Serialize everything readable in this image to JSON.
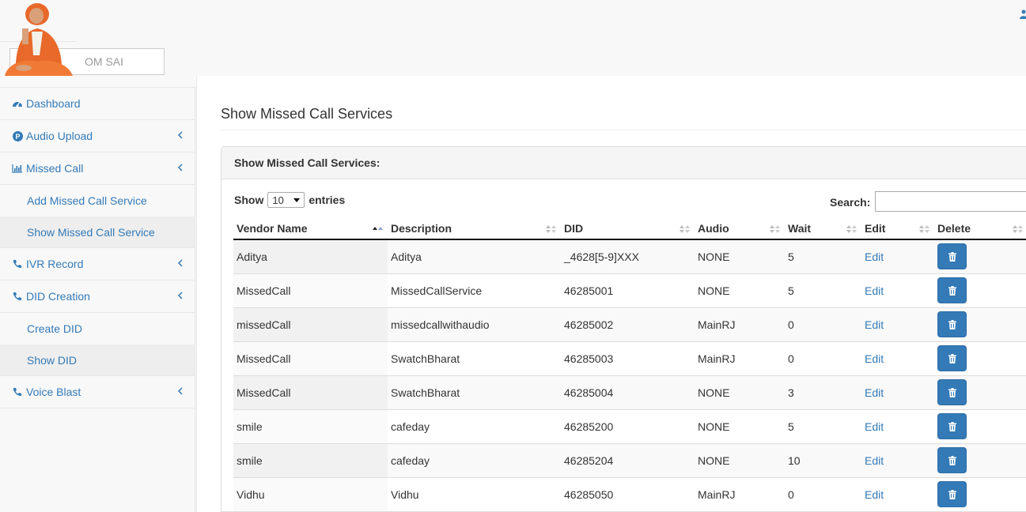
{
  "header": {
    "brand": "OM SAI"
  },
  "sidebar": {
    "items": [
      {
        "label": "Dashboard",
        "icon": "dashboard-icon"
      },
      {
        "label": "Audio Upload",
        "icon": "audio-upload-icon"
      },
      {
        "label": "Missed Call",
        "icon": "bar-chart-icon"
      },
      {
        "label": "Add Missed Call Service"
      },
      {
        "label": "Show Missed Call Service"
      },
      {
        "label": "IVR Record",
        "icon": "phone-icon"
      },
      {
        "label": "DID Creation",
        "icon": "phone-icon"
      },
      {
        "label": "Create DID"
      },
      {
        "label": "Show DID"
      },
      {
        "label": "Voice Blast",
        "icon": "phone-icon"
      }
    ]
  },
  "main": {
    "title": "Show Missed Call Services",
    "panel_title": "Show Missed Call Services:",
    "length": {
      "show": "Show",
      "value": "10",
      "entries": "entries"
    },
    "search": {
      "label": "Search:",
      "value": ""
    },
    "columns": [
      "Vendor Name",
      "Description",
      "DID",
      "Audio",
      "Wait",
      "Edit",
      "Delete"
    ],
    "rows": [
      {
        "vendor": "Aditya",
        "description": "Aditya",
        "did": "_4628[5-9]XXX",
        "audio": "NONE",
        "wait": "5",
        "edit": "Edit"
      },
      {
        "vendor": "MissedCall",
        "description": "MissedCallService",
        "did": "46285001",
        "audio": "NONE",
        "wait": "5",
        "edit": "Edit"
      },
      {
        "vendor": "missedCall",
        "description": "missedcallwithaudio",
        "did": "46285002",
        "audio": "MainRJ",
        "wait": "0",
        "edit": "Edit"
      },
      {
        "vendor": "MissedCall",
        "description": "SwatchBharat",
        "did": "46285003",
        "audio": "MainRJ",
        "wait": "0",
        "edit": "Edit"
      },
      {
        "vendor": "MissedCall",
        "description": "SwatchBharat",
        "did": "46285004",
        "audio": "NONE",
        "wait": "3",
        "edit": "Edit"
      },
      {
        "vendor": "smile",
        "description": "cafeday",
        "did": "46285200",
        "audio": "NONE",
        "wait": "5",
        "edit": "Edit"
      },
      {
        "vendor": "smile",
        "description": "cafeday",
        "did": "46285204",
        "audio": "NONE",
        "wait": "10",
        "edit": "Edit"
      },
      {
        "vendor": "Vidhu",
        "description": "Vidhu",
        "did": "46285050",
        "audio": "MainRJ",
        "wait": "0",
        "edit": "Edit"
      }
    ]
  },
  "colors": {
    "link": "#337ab7",
    "button": "#337ab7",
    "logo_robe": "#e8692a"
  }
}
